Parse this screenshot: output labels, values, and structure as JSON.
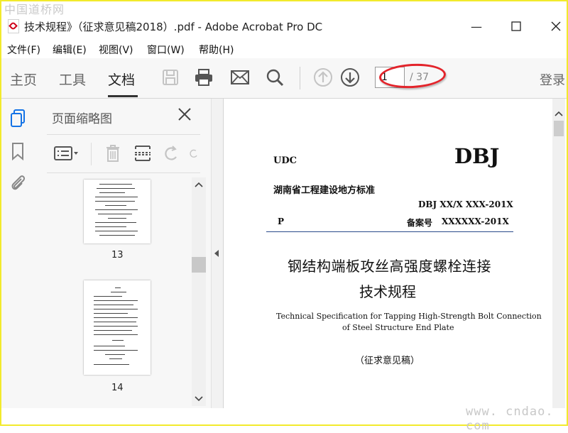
{
  "watermark_top": "中国道桥网",
  "watermark_bottom": "www. cndao. com",
  "window": {
    "title": "技术规程》（征求意见稿2018）.pdf - Adobe Acrobat Pro DC",
    "minimize": "—",
    "maximize": "☐",
    "close": "✕"
  },
  "menu": [
    "文件(F)",
    "编辑(E)",
    "视图(V)",
    "窗口(W)",
    "帮助(H)"
  ],
  "toolbar": {
    "tabs": [
      "主页",
      "工具",
      "文档"
    ],
    "active_tab": "文档",
    "page_current": "1",
    "page_total": "/ 37",
    "login": "登录"
  },
  "panel": {
    "title": "页面缩略图",
    "thumbs": [
      {
        "label": "13"
      },
      {
        "label": "14"
      }
    ]
  },
  "document": {
    "udc": "UDC",
    "dbj": "DBJ",
    "standard": "湖南省工程建设地方标准",
    "code": "DBJ XX/X XXX-201X",
    "p": "P",
    "record_label": "备案号",
    "record_value": "XXXXXX-201X",
    "title_cn_1": "钢结构端板攻丝高强度螺栓连接",
    "title_cn_2": "技术规程",
    "title_en_1": "Technical Specification for Tapping High-Strength Bolt Connection",
    "title_en_2": "of Steel Structure End Plate",
    "draft": "（征求意见稿）"
  },
  "colors": {
    "frame": "#f2ea2c",
    "annotation": "#e3242b",
    "rail_active": "#1473e6"
  }
}
